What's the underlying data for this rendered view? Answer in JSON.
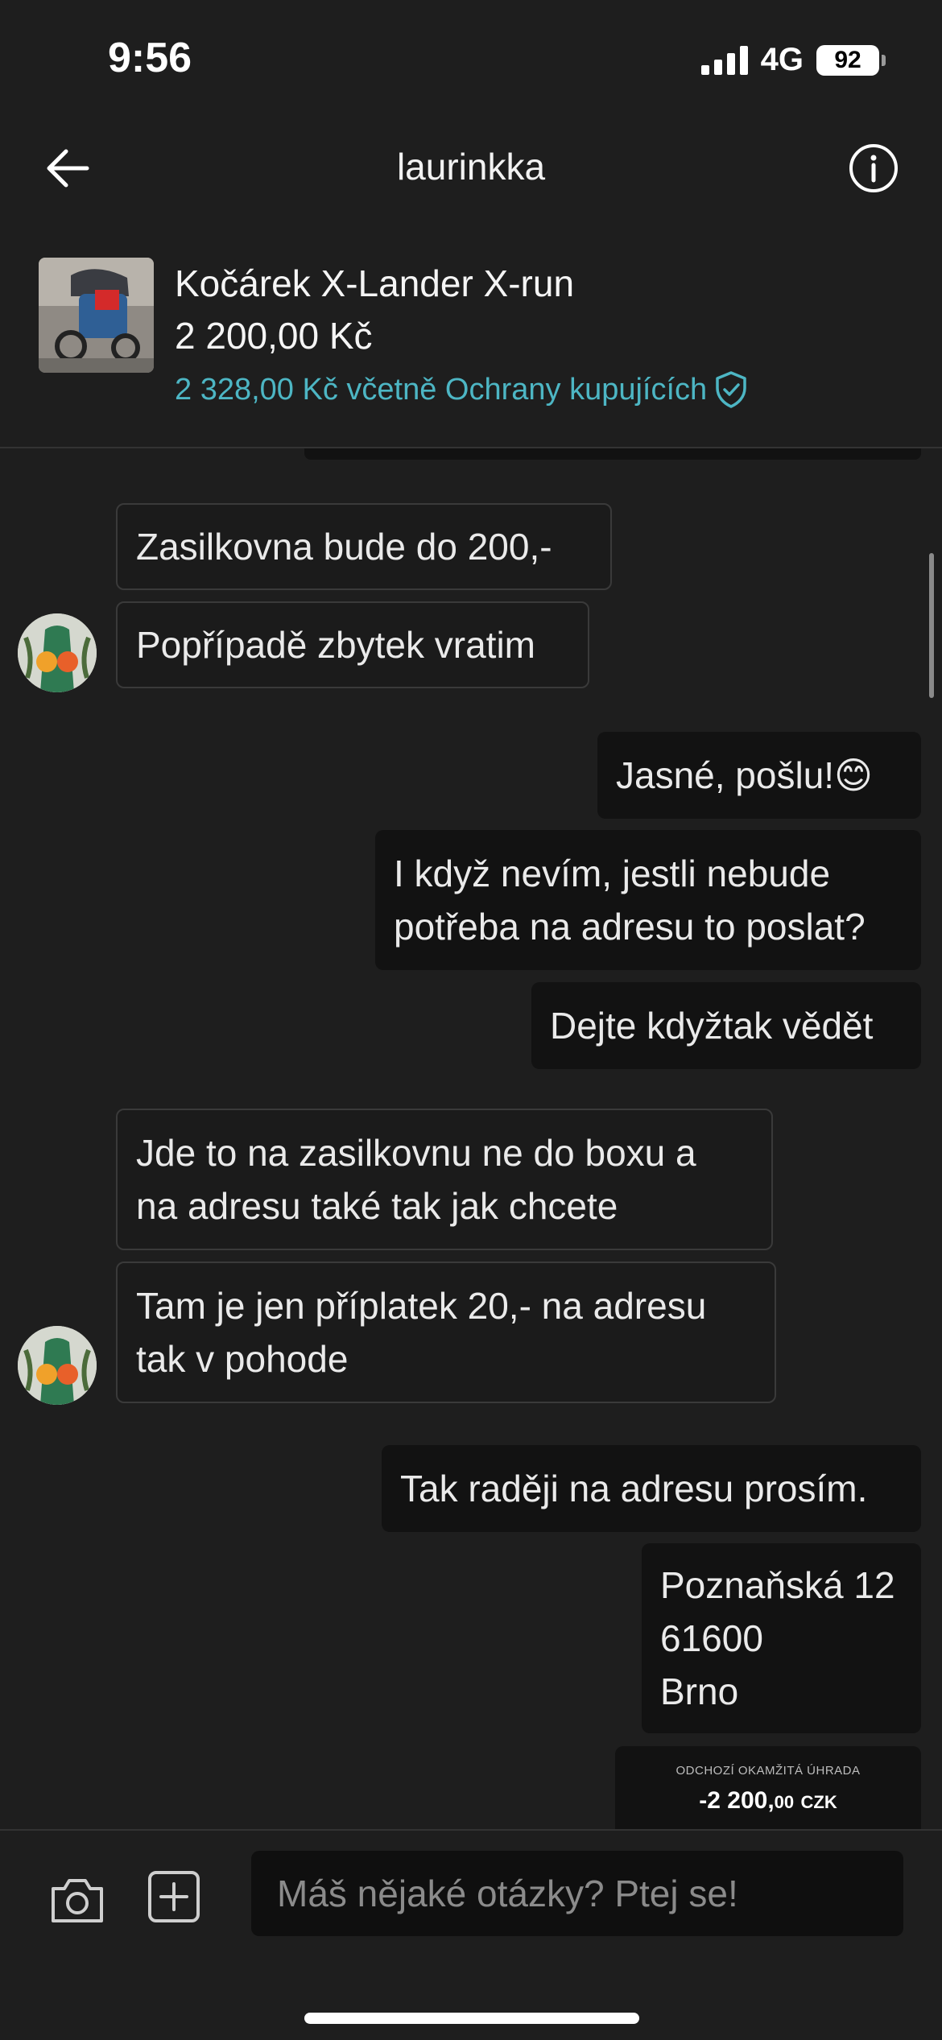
{
  "status_bar": {
    "time": "9:56",
    "network": "4G",
    "battery": "92"
  },
  "header": {
    "title": "laurinkka"
  },
  "item": {
    "title": "Kočárek X-Lander X-run",
    "price": "2 200,00 Kč",
    "protection_price": "2 328,00 Kč včetně Ochrany kupujících"
  },
  "messages": [
    {
      "from": "seller",
      "text": "Zasilkovna bude do 200,-"
    },
    {
      "from": "seller",
      "text": "Popřípadě zbytek vratim"
    },
    {
      "from": "me",
      "text": "Jasné, pošlu!😊"
    },
    {
      "from": "me",
      "text": "I když nevím, jestli nebude\npotřeba na adresu to poslat?"
    },
    {
      "from": "me",
      "text": "Dejte kdyžtak vědět"
    },
    {
      "from": "seller",
      "text": "Jde to na zasilkovnu ne do boxu a\nna adresu také tak jak chcete"
    },
    {
      "from": "seller",
      "text": "Tam je jen příplatek 20,- na adresu\ntak v pohode"
    },
    {
      "from": "me",
      "text": "Tak raději na adresu prosím."
    },
    {
      "from": "me",
      "text": "Poznaňská 12\n61600\nBrno"
    }
  ],
  "payment_card": {
    "label": "ODCHOZÍ OKAMŽITÁ ÚHRADA",
    "amount_main": "-2 200,",
    "amount_decimals": "00",
    "currency": "CZK"
  },
  "composer": {
    "placeholder": "Máš nějaké otázky? Ptej se!"
  },
  "icons": [
    "back-arrow-icon",
    "info-icon",
    "shield-check-icon",
    "camera-icon",
    "add-icon"
  ],
  "colors": {
    "background": "#1e1e1e",
    "accent": "#4db6c4"
  }
}
